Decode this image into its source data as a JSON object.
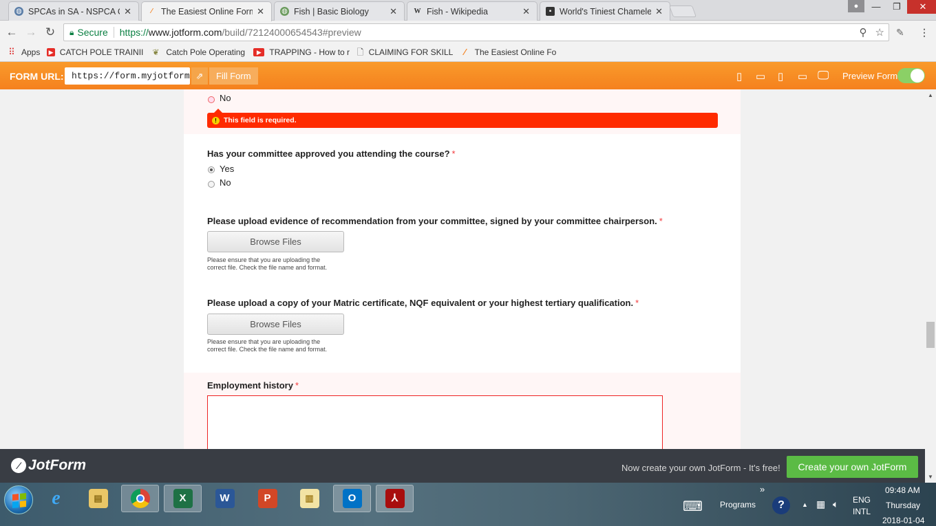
{
  "tabs": [
    {
      "title": "SPCAs in SA - NSPCA Ca",
      "icon": "globe-icon",
      "active": false
    },
    {
      "title": "The Easiest Online Form",
      "icon": "jotform-icon",
      "active": true
    },
    {
      "title": "Fish | Basic Biology",
      "icon": "globe-icon",
      "active": false
    },
    {
      "title": "Fish - Wikipedia",
      "icon": "wikipedia-icon",
      "active": false
    },
    {
      "title": "World's Tiniest Chamelec",
      "icon": "site-icon",
      "active": false
    }
  ],
  "tab_close": "✕",
  "omnibox": {
    "secure_label": "Secure",
    "scheme": "https://",
    "host": "www.jotform.com",
    "path": "/build/72124000654543#preview"
  },
  "bookmarks": [
    {
      "label": "Apps",
      "icon": "apps-grid-icon"
    },
    {
      "label": "CATCH POLE TRAINII",
      "icon": "youtube-icon"
    },
    {
      "label": "Catch Pole Operating",
      "icon": "site-icon"
    },
    {
      "label": "TRAPPING - How to r",
      "icon": "youtube-icon"
    },
    {
      "label": "CLAIMING FOR SKILL",
      "icon": "page-icon"
    },
    {
      "label": "The Easiest Online Fo",
      "icon": "jotform-icon"
    }
  ],
  "jotform_bar": {
    "form_url_label": "FORM URL:",
    "form_url_value": "https://form.myjotform.c",
    "fill_form": "Fill Form",
    "preview_form": "Preview Form"
  },
  "form": {
    "prev_option_no": "No",
    "error_text": "This field is required.",
    "q_committee": "Has your committee approved you attending the course?",
    "opt_yes": "Yes",
    "opt_no": "No",
    "selected": "Yes",
    "q_recommendation": "Please upload evidence of recommendation from your committee, signed by your committee chairperson.",
    "browse_label": "Browse Files",
    "upload_hint_1": "Please ensure that you are uploading the",
    "upload_hint_2": "correct file. Check the file name and format.",
    "q_matric": "Please upload a copy of your Matric certificate, NQF equivalent or your highest tertiary qualification.",
    "q_employment": "Employment history",
    "required_mark": "*"
  },
  "footer": {
    "logo": "JotForm",
    "promo": "Now create your own JotForm - It's free!",
    "cta": "Create your own JotForm"
  },
  "taskbar": {
    "programs_label": "Programs",
    "lang_1": "ENG",
    "lang_2": "INTL",
    "time": "09:48 AM",
    "day": "Thursday",
    "date": "2018-01-04",
    "chevron": "»"
  },
  "colors": {
    "jotform_orange": "#f5811e",
    "error_red": "#ff2b00",
    "cta_green": "#5bbb45",
    "secure_green": "#0b8043"
  }
}
